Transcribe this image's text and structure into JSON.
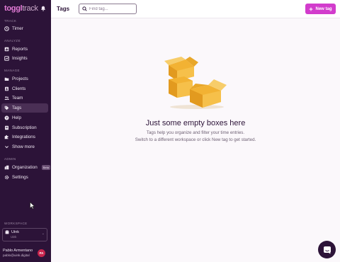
{
  "brand": {
    "name": "toggl",
    "suffix": "track"
  },
  "sidebar": {
    "sections": {
      "track": "TRACK",
      "analyze": "ANALYZE",
      "manage": "MANAGE",
      "admin": "ADMIN",
      "workspace": "WORKSPACE"
    },
    "items": {
      "timer": "Timer",
      "reports": "Reports",
      "insights": "Insights",
      "projects": "Projects",
      "clients": "Clients",
      "team": "Team",
      "tags": "Tags",
      "help": "Help",
      "subscription": "Subscription",
      "integrations": "Integrations",
      "show_more": "Show more",
      "organization": "Organization",
      "organization_badge": "Beta",
      "settings": "Settings"
    },
    "workspace": {
      "name": "Uink",
      "sub": "Uink"
    },
    "user": {
      "name": "Pablo Armentano",
      "email": "pablo@uink.digital",
      "initials": "PA"
    }
  },
  "header": {
    "title": "Tags",
    "search_placeholder": "Find tag...",
    "new_tag_label": "New tag"
  },
  "empty_state": {
    "title": "Just some empty boxes here",
    "line1": "Tags help you organize and filter your time entries.",
    "line2": "Switch to a different workspace or click New tag to get started."
  },
  "colors": {
    "sidebar_bg": "#2c1338",
    "accent": "#d23ccc",
    "brand": "#e57cd8",
    "avatar": "#c7254e"
  }
}
